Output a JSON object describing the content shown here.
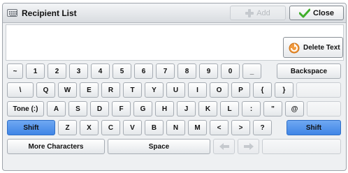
{
  "window": {
    "title": "Recipient List",
    "add_label": "Add",
    "close_label": "Close"
  },
  "actions": {
    "delete_text_label": "Delete Text"
  },
  "keyboard": {
    "row1": [
      "~",
      "1",
      "2",
      "3",
      "4",
      "5",
      "6",
      "7",
      "8",
      "9",
      "0",
      "_"
    ],
    "backspace_label": "Backspace",
    "row2": [
      "\\",
      "Q",
      "W",
      "E",
      "R",
      "T",
      "Y",
      "U",
      "I",
      "O",
      "P",
      "{",
      "}"
    ],
    "tone_label": "Tone (:)",
    "row3": [
      "A",
      "S",
      "D",
      "F",
      "G",
      "H",
      "J",
      "K",
      "L",
      ":",
      "\"",
      "@"
    ],
    "shift_label": "Shift",
    "row4": [
      "Z",
      "X",
      "C",
      "V",
      "B",
      "N",
      "M",
      "<",
      ">",
      "?"
    ],
    "more_chars_label": "More Characters",
    "space_label": "Space"
  },
  "colors": {
    "shift_active": "#3f85e6",
    "close_check": "#3fae2a"
  }
}
